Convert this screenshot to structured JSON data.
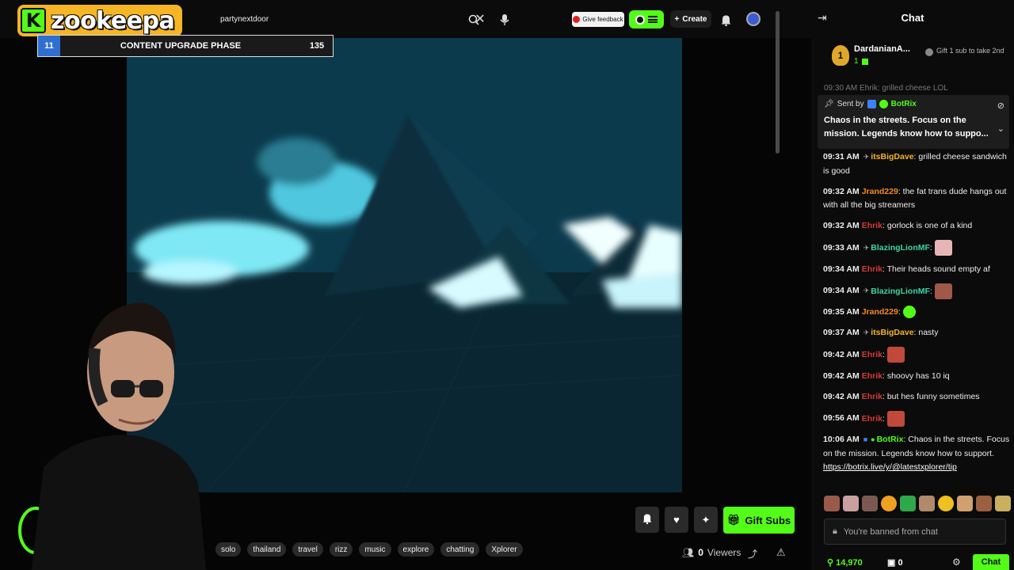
{
  "topbar": {
    "logo_k": "K",
    "logo_text": "zookeepa",
    "search_value": "partynextdoor",
    "feedback_label": "Give feedback",
    "create_label": "Create"
  },
  "upgrade": {
    "level": "11",
    "title": "CONTENT UPGRADE PHASE",
    "count": "135"
  },
  "controls": {
    "gift_label": "Gift Subs",
    "viewers_count": "0",
    "viewers_label": "Viewers",
    "tags": [
      "solo",
      "thailand",
      "travel",
      "rizz",
      "music",
      "explore",
      "chatting",
      "Xplorer"
    ]
  },
  "chat": {
    "title": "Chat",
    "leader": {
      "rank": "1",
      "name": "DardanianA...",
      "count": "1",
      "gift_hint": "Gift 1 sub to take 2nd"
    },
    "partial_line": "09:30 AM  Ehrik: grilled cheese LOL",
    "pinned": {
      "sent_by": "Sent by",
      "bot_name": "BotRix",
      "message": "Chaos in the streets. Focus on the mission. Legends know how to suppo..."
    },
    "messages": [
      {
        "time": "09:31 AM",
        "user": "itsBigDave",
        "color": "#f5b524",
        "text": ": grilled cheese sandwich is good"
      },
      {
        "time": "09:32 AM",
        "user": "Jrand229",
        "color": "#f08a24",
        "text": ": the fat trans dude hangs out with all the big streamers"
      },
      {
        "time": "09:32 AM",
        "user": "Ehrik",
        "color": "#d83a3a",
        "text": ": gorlock is one of a kind"
      },
      {
        "time": "09:33 AM",
        "user": "BlazingLionMF",
        "color": "#3ad6a6",
        "text": ":"
      },
      {
        "time": "09:34 AM",
        "user": "Ehrik",
        "color": "#d83a3a",
        "text": ": Their heads sound empty af"
      },
      {
        "time": "09:34 AM",
        "user": "BlazingLionMF",
        "color": "#3ad6a6",
        "text": ":"
      },
      {
        "time": "09:35 AM",
        "user": "Jrand229",
        "color": "#f08a24",
        "text": ":"
      },
      {
        "time": "09:37 AM",
        "user": "itsBigDave",
        "color": "#f5b524",
        "text": ": nasty"
      },
      {
        "time": "09:42 AM",
        "user": "Ehrik",
        "color": "#d83a3a",
        "text": ":"
      },
      {
        "time": "09:42 AM",
        "user": "Ehrik",
        "color": "#d83a3a",
        "text": ": shoovy has 10 iq"
      },
      {
        "time": "09:42 AM",
        "user": "Ehrik",
        "color": "#d83a3a",
        "text": ": but hes funny sometimes"
      },
      {
        "time": "09:56 AM",
        "user": "Ehrik",
        "color": "#d83a3a",
        "text": ":"
      },
      {
        "time": "10:06 AM",
        "user": "BotRix",
        "color": "#53fc18",
        "text": ": Chaos in the streets. Focus on the mission. Legends know how to support."
      }
    ],
    "link": "https://botrix.live/y/@latestxplorer/tip",
    "banned_text": "You're banned from chat",
    "points": "14,970",
    "points2": "0",
    "send_label": "Chat"
  }
}
